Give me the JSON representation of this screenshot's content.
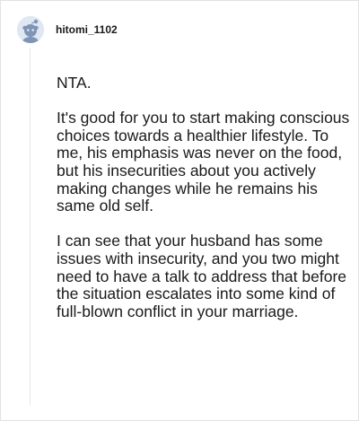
{
  "comment": {
    "username": "hitomi_1102",
    "avatar_icon": "snoo-avatar-icon",
    "paragraphs": [
      "NTA.",
      "It's good for you to start making conscious choices towards a healthier lifestyle. To me, his emphasis was never on the food, but his insecurities about you actively making changes while he remains his same old self.",
      "I can see that your husband has some issues with insecurity, and you two might need to have a talk to address that before the situation escalates into some kind of full-blown conflict in your marriage."
    ]
  },
  "colors": {
    "text": "#1a1a1b",
    "avatar_bg": "#dfe7f2",
    "avatar_figure": "#7f95b5",
    "border": "#e2e2e2"
  }
}
